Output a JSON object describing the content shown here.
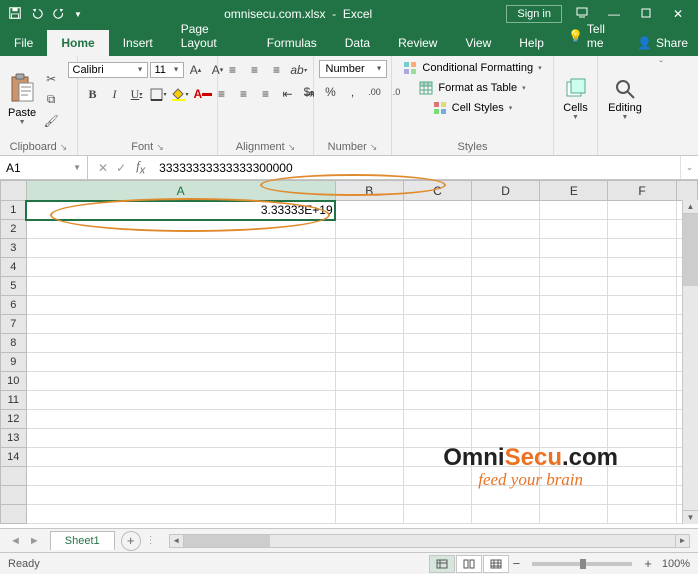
{
  "titlebar": {
    "filename": "omnisecu.com.xlsx",
    "appname": "Excel",
    "signin": "Sign in"
  },
  "tabs": {
    "file": "File",
    "home": "Home",
    "insert": "Insert",
    "pagelayout": "Page Layout",
    "formulas": "Formulas",
    "data": "Data",
    "review": "Review",
    "view": "View",
    "help": "Help",
    "tellme": "Tell me",
    "share": "Share"
  },
  "ribbon": {
    "clipboard": {
      "label": "Clipboard",
      "paste": "Paste"
    },
    "font": {
      "label": "Font",
      "name": "Calibri",
      "size": "11"
    },
    "alignment": {
      "label": "Alignment"
    },
    "number": {
      "label": "Number",
      "format": "Number"
    },
    "styles": {
      "label": "Styles",
      "condformat": "Conditional Formatting",
      "fmttable": "Format as Table",
      "cellstyles": "Cell Styles"
    },
    "cells": {
      "label": "Cells"
    },
    "editing": {
      "label": "Editing"
    }
  },
  "namebox": "A1",
  "formulabar": "33333333333333300000",
  "grid": {
    "columns": [
      "A",
      "B",
      "C",
      "D",
      "E",
      "F"
    ],
    "rows": [
      "1",
      "2",
      "3",
      "4",
      "5",
      "6",
      "7",
      "8",
      "9",
      "10",
      "11",
      "12",
      "13",
      "14"
    ],
    "cellA1": "3.33333E+19"
  },
  "watermark": {
    "omni": "Omni",
    "secu": "Secu",
    "dotcom": ".com",
    "tagline": "feed your brain"
  },
  "sheets": {
    "sheet1": "Sheet1"
  },
  "statusbar": {
    "ready": "Ready",
    "zoom": "100%"
  }
}
